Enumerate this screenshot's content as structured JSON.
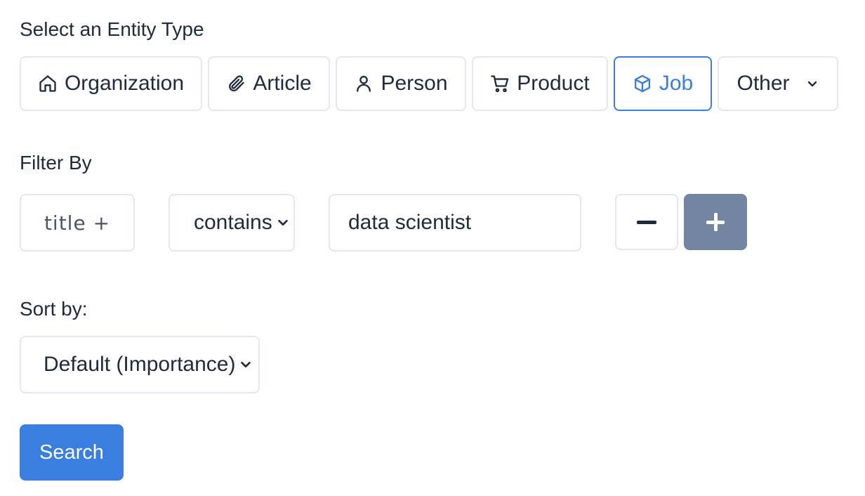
{
  "entity_section": {
    "label": "Select an Entity Type",
    "options": [
      {
        "label": "Organization",
        "icon": "home-icon"
      },
      {
        "label": "Article",
        "icon": "paperclip-icon"
      },
      {
        "label": "Person",
        "icon": "user-icon"
      },
      {
        "label": "Product",
        "icon": "cart-icon"
      },
      {
        "label": "Job",
        "icon": "box-icon",
        "selected": true
      },
      {
        "label": "Other",
        "icon": "chevron-down-icon"
      }
    ]
  },
  "filter_section": {
    "label": "Filter By",
    "field_label": "title +",
    "operator_value": "contains",
    "value": "data scientist",
    "remove_symbol": "−",
    "add_symbol": "+"
  },
  "sort_section": {
    "label": "Sort by:",
    "selected": "Default (Importance)"
  },
  "search_button": {
    "label": "Search"
  },
  "colors": {
    "accent": "#3a7ee0",
    "border": "#e3e7ef",
    "text": "#1e2b3d",
    "plus_button_bg": "#7286a4"
  }
}
